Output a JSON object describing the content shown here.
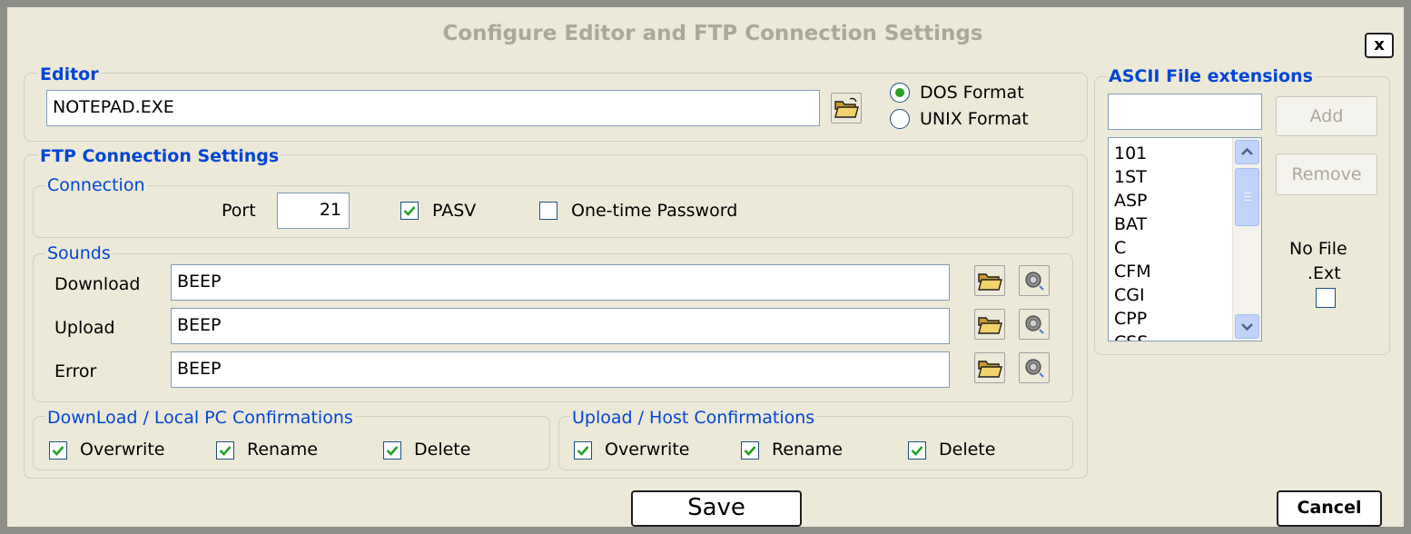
{
  "window": {
    "title": "Configure Editor and FTP Connection Settings",
    "close_label": "x"
  },
  "editor": {
    "label": "Editor",
    "path": "NOTEPAD.EXE",
    "browse_icon": "folder-open-icon",
    "dos_label": "DOS Format",
    "unix_label": "UNIX Format",
    "selected_format": "DOS Format"
  },
  "ftp": {
    "label": "FTP Connection Settings",
    "connection": {
      "label": "Connection",
      "port_label": "Port",
      "port_value": "21",
      "pasv_label": "PASV",
      "pasv_checked": true,
      "otp_label": "One-time Password",
      "otp_checked": false
    },
    "sounds": {
      "label": "Sounds",
      "download_label": "Download",
      "download_value": "BEEP",
      "upload_label": "Upload",
      "upload_value": "BEEP",
      "error_label": "Error",
      "error_value": "BEEP",
      "browse_icon": "folder-open-icon",
      "play_icon": "speaker-icon"
    },
    "download_confirm": {
      "label": "DownLoad / Local PC Confirmations",
      "overwrite_label": "Overwrite",
      "rename_label": "Rename",
      "delete_label": "Delete",
      "overwrite_checked": true,
      "rename_checked": true,
      "delete_checked": true
    },
    "upload_confirm": {
      "label": "Upload / Host Confirmations",
      "overwrite_label": "Overwrite",
      "rename_label": "Rename",
      "delete_label": "Delete",
      "overwrite_checked": true,
      "rename_checked": true,
      "delete_checked": true
    }
  },
  "ascii": {
    "label": "ASCII File extensions",
    "input_value": "",
    "add_label": "Add",
    "remove_label": "Remove",
    "items": [
      "101",
      "1ST",
      "ASP",
      "BAT",
      "C",
      "CFM",
      "CGI",
      "CPP",
      "CSS"
    ],
    "no_ext_label_1": "No File",
    "no_ext_label_2": ".Ext",
    "no_ext_checked": false
  },
  "footer": {
    "save_label": "Save",
    "cancel_label": "Cancel"
  },
  "colors": {
    "accent": "#0046d5",
    "check": "#21a121",
    "background": "#ece9d8",
    "title_disabled": "#aca899"
  }
}
